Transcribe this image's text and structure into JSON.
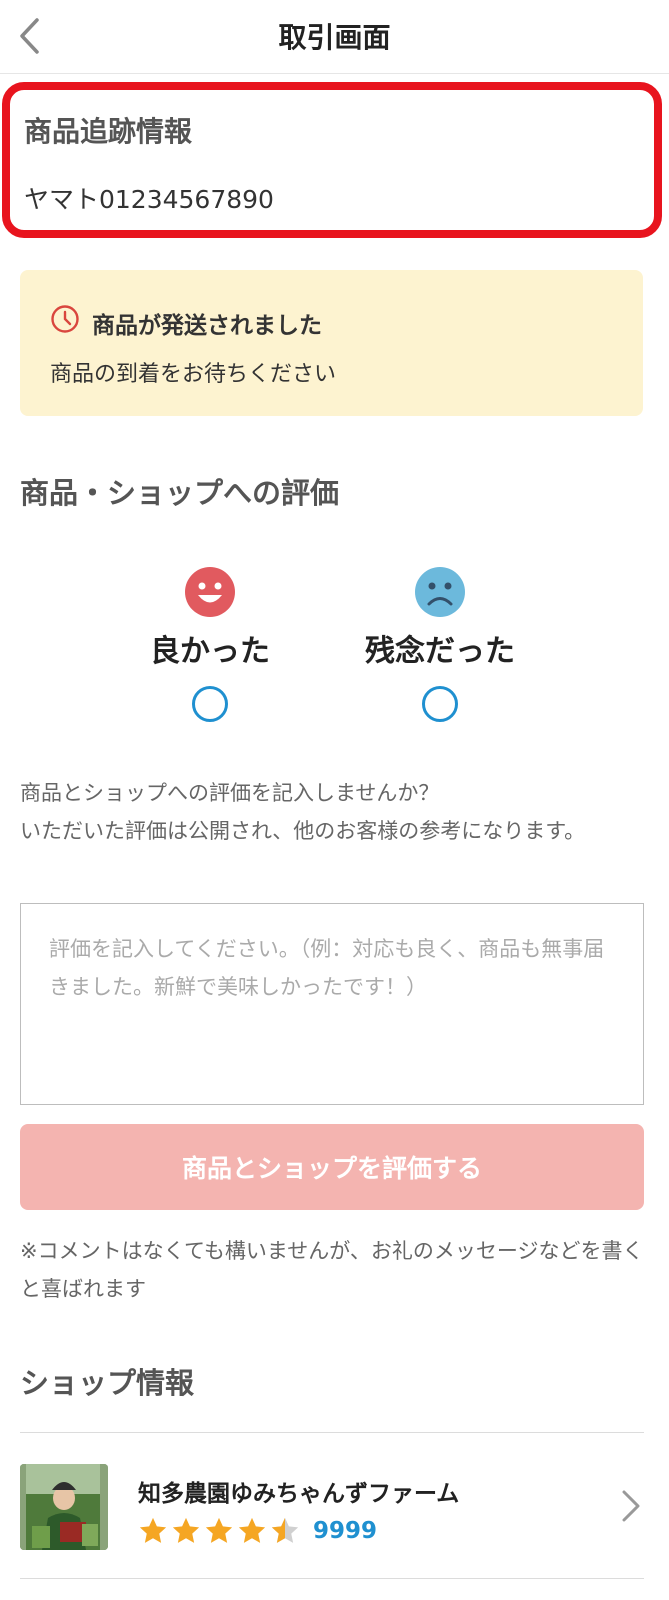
{
  "header": {
    "title": "取引画面",
    "back_icon": "chevron-left-icon"
  },
  "tracking": {
    "title": "商品追跡情報",
    "number": "ヤマト01234567890",
    "highlight_color": "#e8141e"
  },
  "status": {
    "icon": "clock-icon",
    "title": "商品が発送されました",
    "subtitle": "商品の到着をお待ちください"
  },
  "review": {
    "section_title": "商品・ショップへの評価",
    "options": [
      {
        "label": "良かった",
        "icon": "smile-face-icon",
        "color": "#e15a5f"
      },
      {
        "label": "残念だった",
        "icon": "sad-face-icon",
        "color": "#6cb9dc"
      }
    ],
    "description": "商品とショップへの評価を記入しませんか？\nいただいた評価は公開され、他のお客様の参考になります。",
    "comment_placeholder": "評価を記入してください。（例：対応も良く、商品も無事届きました。新鮮で美味しかったです！）",
    "submit_label": "商品とショップを評価する",
    "note": "※コメントはなくても構いませんが、お礼のメッセージなどを書くと喜ばれます"
  },
  "shop": {
    "section_title": "ショップ情報",
    "name": "知多農園ゆみちゃんずファーム",
    "rating": 4.5,
    "review_count": "9999",
    "accent_color": "#1f90d0"
  }
}
